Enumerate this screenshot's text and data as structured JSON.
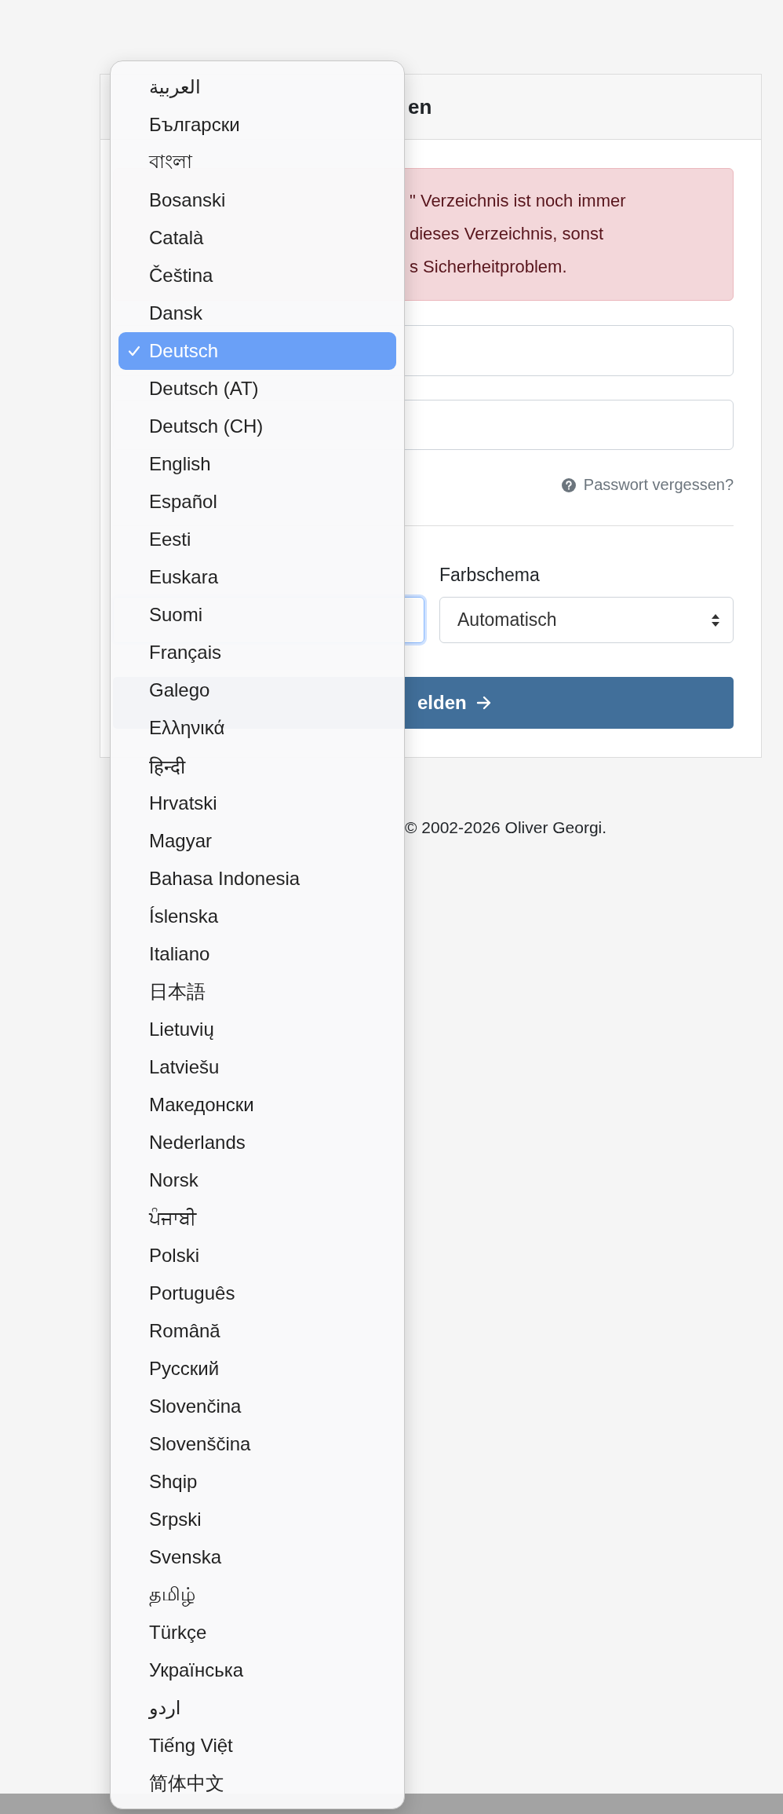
{
  "card": {
    "title": "en",
    "alert_lines": [
      "\" Verzeichnis ist noch immer",
      "dieses Verzeichnis, sonst",
      "s Sicherheitproblem."
    ],
    "forgot_password": "Passwort vergessen?",
    "language_select": {
      "focused": true
    },
    "color_scheme": {
      "label": "Farbschema",
      "value": "Automatisch"
    },
    "submit_button": {
      "label": "elden"
    }
  },
  "footer": "© 2002-2026 Oliver Georgi.",
  "language_menu": {
    "items": [
      {
        "label": "العربية",
        "selected": false
      },
      {
        "label": "Български",
        "selected": false
      },
      {
        "label": "বাংলা",
        "selected": false
      },
      {
        "label": "Bosanski",
        "selected": false
      },
      {
        "label": "Català",
        "selected": false
      },
      {
        "label": "Čeština",
        "selected": false
      },
      {
        "label": "Dansk",
        "selected": false
      },
      {
        "label": "Deutsch",
        "selected": true
      },
      {
        "label": "Deutsch (AT)",
        "selected": false
      },
      {
        "label": "Deutsch (CH)",
        "selected": false
      },
      {
        "label": "English",
        "selected": false
      },
      {
        "label": "Español",
        "selected": false
      },
      {
        "label": "Eesti",
        "selected": false
      },
      {
        "label": "Euskara",
        "selected": false
      },
      {
        "label": "Suomi",
        "selected": false
      },
      {
        "label": "Français",
        "selected": false
      },
      {
        "label": "Galego",
        "selected": false
      },
      {
        "label": "Ελληνικά",
        "selected": false
      },
      {
        "label": "हिन्दी",
        "selected": false
      },
      {
        "label": "Hrvatski",
        "selected": false
      },
      {
        "label": "Magyar",
        "selected": false
      },
      {
        "label": "Bahasa Indonesia",
        "selected": false
      },
      {
        "label": "Íslenska",
        "selected": false
      },
      {
        "label": "Italiano",
        "selected": false
      },
      {
        "label": "日本語",
        "selected": false
      },
      {
        "label": "Lietuvių",
        "selected": false
      },
      {
        "label": "Latviešu",
        "selected": false
      },
      {
        "label": "Македонски",
        "selected": false
      },
      {
        "label": "Nederlands",
        "selected": false
      },
      {
        "label": "Norsk",
        "selected": false
      },
      {
        "label": "ਪੰਜਾਬੀ",
        "selected": false
      },
      {
        "label": "Polski",
        "selected": false
      },
      {
        "label": "Português",
        "selected": false
      },
      {
        "label": "Română",
        "selected": false
      },
      {
        "label": "Русский",
        "selected": false
      },
      {
        "label": "Slovenčina",
        "selected": false
      },
      {
        "label": "Slovenščina",
        "selected": false
      },
      {
        "label": "Shqip",
        "selected": false
      },
      {
        "label": "Srpski",
        "selected": false
      },
      {
        "label": "Svenska",
        "selected": false
      },
      {
        "label": "தமிழ்",
        "selected": false
      },
      {
        "label": "Türkçe",
        "selected": false
      },
      {
        "label": "Українська",
        "selected": false
      },
      {
        "label": "اردو",
        "selected": false
      },
      {
        "label": "Tiếng Việt",
        "selected": false
      },
      {
        "label": "简体中文",
        "selected": false
      }
    ]
  }
}
